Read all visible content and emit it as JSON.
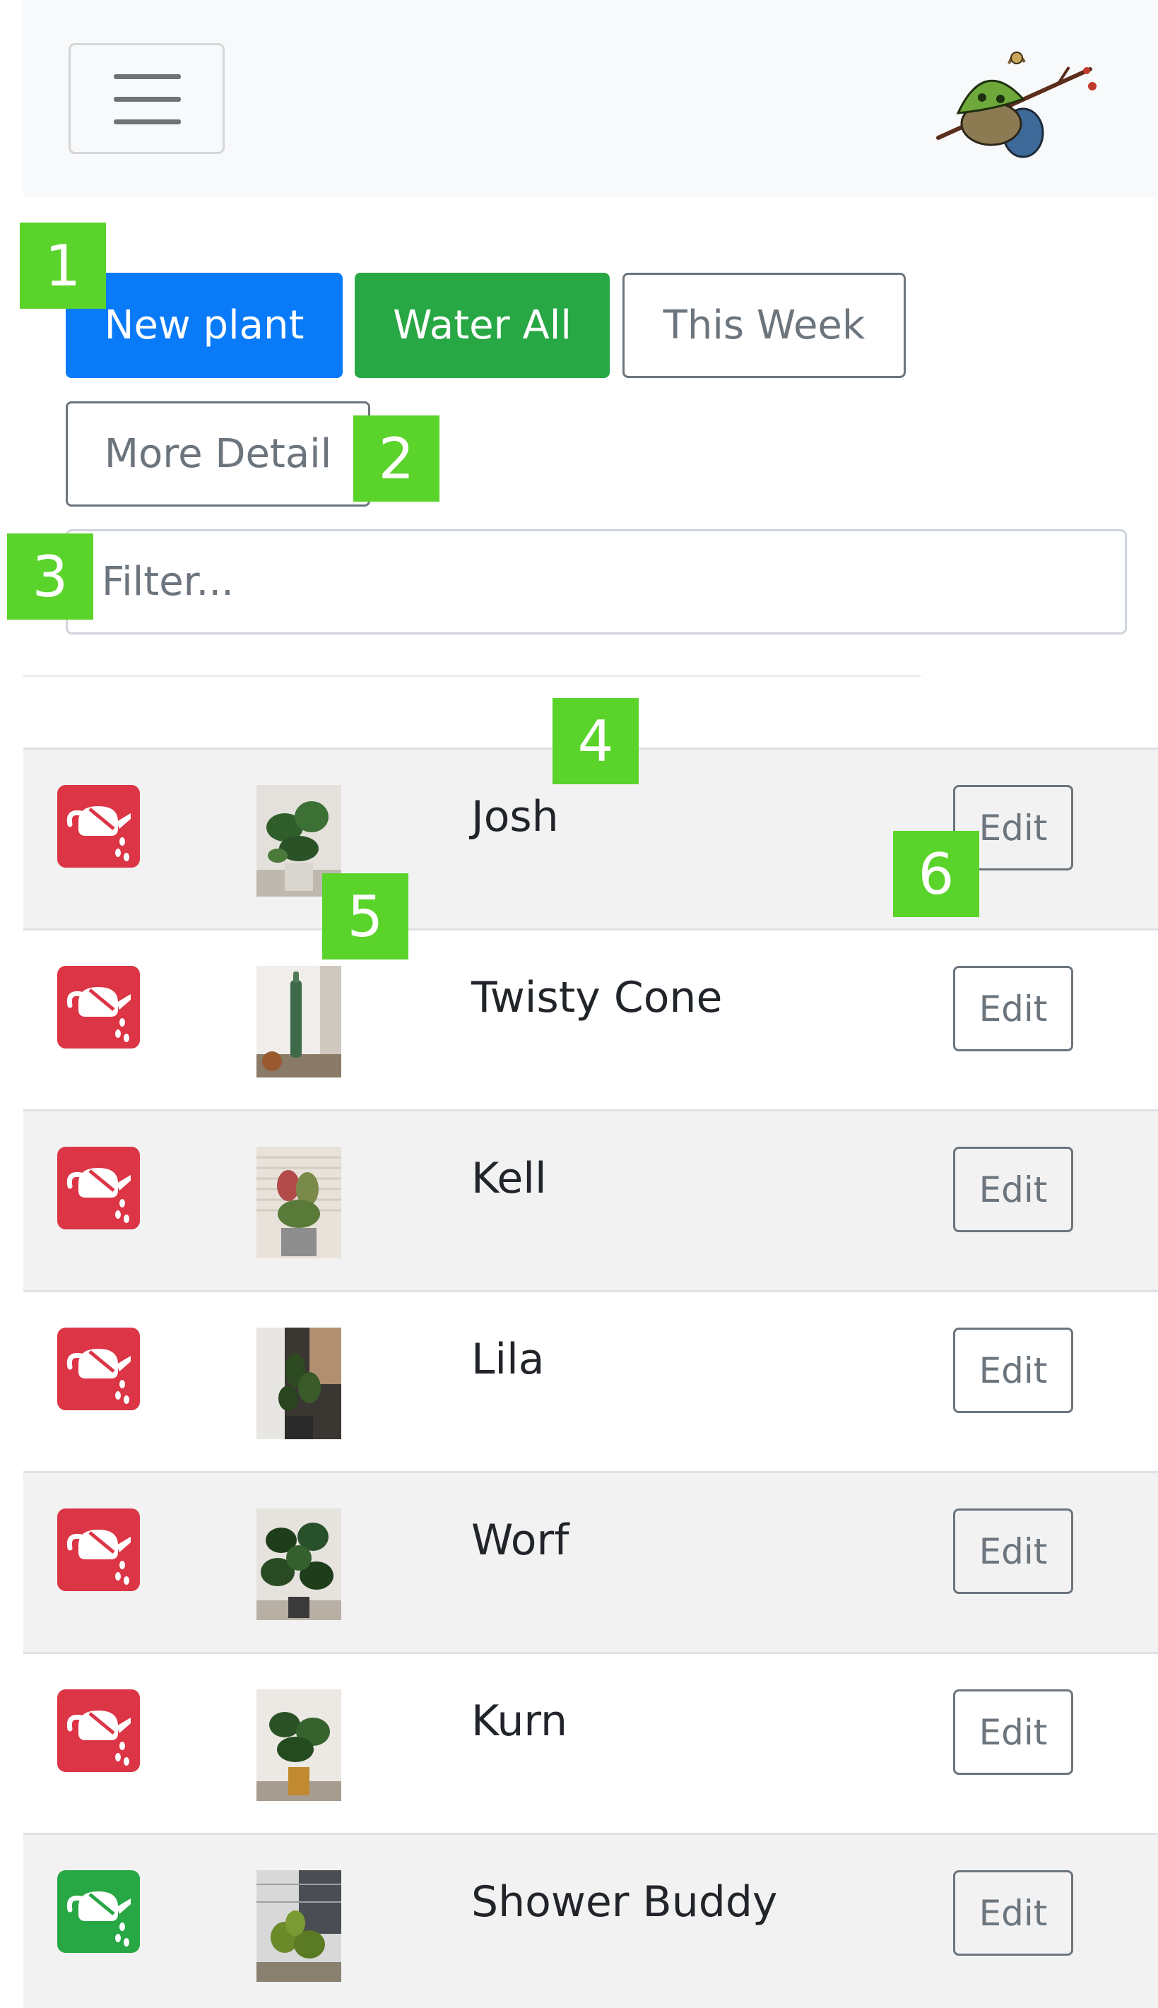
{
  "navbar": {
    "toggle_icon": "hamburger-menu-icon",
    "logo_icon": "korok-logo-icon"
  },
  "toolbar": {
    "new_plant_label": "New plant",
    "water_all_label": "Water All",
    "this_week_label": "This Week",
    "more_detail_label": "More Detail"
  },
  "filter": {
    "placeholder": "Filter...",
    "value": ""
  },
  "plants": [
    {
      "name": "Josh",
      "water_status": "due",
      "water_icon": "watering-can-icon",
      "edit_label": "Edit"
    },
    {
      "name": "Twisty Cone",
      "water_status": "due",
      "water_icon": "watering-can-icon",
      "edit_label": "Edit"
    },
    {
      "name": "Kell",
      "water_status": "due",
      "water_icon": "watering-can-icon",
      "edit_label": "Edit"
    },
    {
      "name": "Lila",
      "water_status": "due",
      "water_icon": "watering-can-icon",
      "edit_label": "Edit"
    },
    {
      "name": "Worf",
      "water_status": "due",
      "water_icon": "watering-can-icon",
      "edit_label": "Edit"
    },
    {
      "name": "Kurn",
      "water_status": "due",
      "water_icon": "watering-can-icon",
      "edit_label": "Edit"
    },
    {
      "name": "Shower Buddy",
      "water_status": "ok",
      "water_icon": "watering-can-icon",
      "edit_label": "Edit"
    }
  ],
  "markers": [
    "1",
    "2",
    "3",
    "4",
    "5",
    "6"
  ],
  "colors": {
    "primary": "#0a7bf8",
    "success": "#28a745",
    "danger": "#dc3545",
    "secondary": "#6c757d",
    "marker": "#5ad32a",
    "navbar_bg": "#f8f9fa",
    "row_stripe": "#f2f2f2"
  }
}
